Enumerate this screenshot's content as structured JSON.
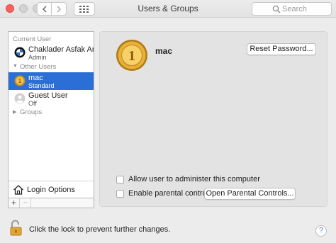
{
  "window": {
    "title": "Users & Groups"
  },
  "toolbar": {
    "search_placeholder": "Search"
  },
  "sidebar": {
    "current_user_heading": "Current User",
    "current_user": {
      "name": "Chaklader Asfak Ar...",
      "role": "Admin"
    },
    "other_users_heading": "Other Users",
    "other_users": [
      {
        "name": "mac",
        "role": "Standard",
        "selected": true
      },
      {
        "name": "Guest User",
        "role": "Off",
        "selected": false
      }
    ],
    "groups_heading": "Groups",
    "login_options_label": "Login Options",
    "add_label": "+",
    "remove_label": "−"
  },
  "detail": {
    "account_name": "mac",
    "reset_password_label": "Reset Password...",
    "allow_admin_label": "Allow user to administer this computer",
    "enable_parental_label": "Enable parental controls",
    "open_parental_label": "Open Parental Controls..."
  },
  "footer": {
    "lock_text": "Click the lock to prevent further changes.",
    "help_label": "?"
  },
  "colors": {
    "selection": "#2b6fd6",
    "close": "#fc605c"
  }
}
